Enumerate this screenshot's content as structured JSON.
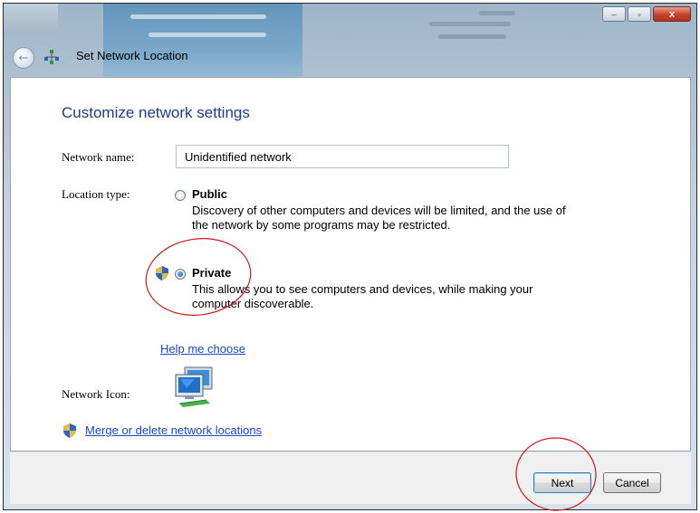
{
  "window": {
    "title": "Set Network Location",
    "controls": {
      "minimize": "–",
      "maximize": "▫",
      "close": "x"
    }
  },
  "main": {
    "heading": "Customize network settings",
    "network_name": {
      "label": "Network name:",
      "value": "Unidentified network"
    },
    "location_type": {
      "label": "Location type:",
      "options": [
        {
          "title": "Public",
          "description": "Discovery of other computers and devices will be limited, and the use of the network by some programs may be restricted.",
          "selected": false
        },
        {
          "title": "Private",
          "description": "This allows you to see computers and devices, while making your computer discoverable.",
          "selected": true
        }
      ]
    },
    "help_link": "Help me choose",
    "network_icon": {
      "label": "Network Icon:",
      "icon": "network-computers-icon"
    },
    "merge_link": "Merge or delete network locations"
  },
  "footer": {
    "next_label": "Next",
    "cancel_label": "Cancel"
  },
  "colors": {
    "heading": "#1e3a8a",
    "link": "#1a46c7",
    "annotation": "#d01818",
    "close_button": "#c7412a"
  }
}
